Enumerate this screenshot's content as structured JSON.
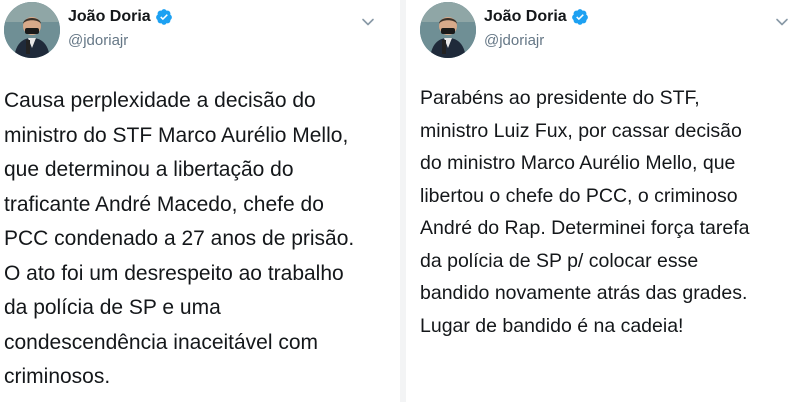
{
  "tweets": [
    {
      "author": {
        "name": "João Doria",
        "handle": "@jdoriajr",
        "verified": true,
        "avatar_icon": "profile-photo"
      },
      "menu_icon": "chevron-down-icon",
      "text_lines": [
        "Causa perplexidade a decisão do",
        "ministro do STF Marco Aurélio Mello,",
        "que determinou a libertação do",
        "traficante André Macedo, chefe do",
        "PCC condenado a 27 anos de prisão.",
        "O ato foi um desrespeito ao trabalho",
        "da polícia de SP e uma",
        "condescendência inaceitável com",
        "criminosos."
      ]
    },
    {
      "author": {
        "name": "João Doria",
        "handle": "@jdoriajr",
        "verified": true,
        "avatar_icon": "profile-photo"
      },
      "menu_icon": "chevron-down-icon",
      "text_lines": [
        "Parabéns ao presidente do STF,",
        "ministro Luiz Fux, por cassar decisão",
        "do ministro Marco Aurélio Mello, que",
        "libertou o chefe do PCC, o criminoso",
        "André do Rap. Determinei força tarefa",
        "da polícia de SP p/ colocar esse",
        "bandido novamente atrás das grades.",
        "Lugar de bandido é na cadeia!"
      ]
    }
  ],
  "colors": {
    "text": "#14171a",
    "secondary": "#657786",
    "verified_blue": "#1da1f2",
    "divider": "#f3f4f5"
  }
}
